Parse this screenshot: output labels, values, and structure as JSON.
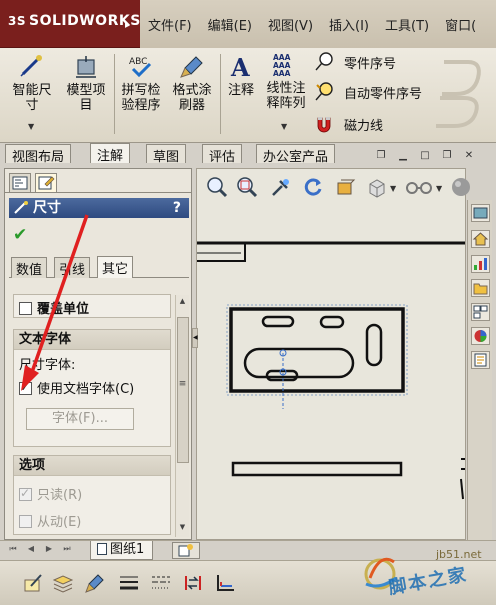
{
  "app": {
    "brand": "SOLIDWORKS",
    "brand_prefix": "3S"
  },
  "menu": [
    "文件(F)",
    "编辑(E)",
    "视图(V)",
    "插入(I)",
    "工具(T)",
    "窗口("
  ],
  "commands": {
    "smart_dimension": "智能尺\n寸",
    "model_items": "模型项\n目",
    "spell_check": "拼写检\n验程序",
    "format_painter": "格式涂\n刷器",
    "note": "注释",
    "linear_pattern": "线性注\n释阵列",
    "balloon": "零件序号",
    "auto_balloon": "自动零件序号",
    "magnetic_line": "磁力线",
    "spell_check_badge": "ABC",
    "pattern_badge": "AAA"
  },
  "tabs": [
    "视图布局",
    "注解",
    "草图",
    "评估",
    "办公室产品"
  ],
  "active_tab": "注解",
  "property_manager": {
    "title": "尺寸",
    "help": "?",
    "subtabs": [
      "数值",
      "引线",
      "其它"
    ],
    "active_subtab": "其它",
    "override_units": {
      "label": "覆盖单位",
      "checked": false
    },
    "text_font": {
      "header": "文本字体",
      "dim_font_label": "尺寸字体:",
      "use_doc_font_label": "使用文档字体(C)",
      "use_doc_font_checked": true,
      "font_button": "字体(F)..."
    },
    "options": {
      "header": "选项",
      "read_only_label": "只读(R)",
      "read_only_checked": true,
      "driven_label": "从动(E)",
      "driven_checked": false
    }
  },
  "sheet_tab": "图纸1",
  "watermark": "脚本之家",
  "watermark_sub": "jb51.net",
  "colors": {
    "title_bar": "#7a1f1d",
    "pm_title": "#2e4a80",
    "arrow": "#e02020",
    "drawing_line": "#111111"
  }
}
